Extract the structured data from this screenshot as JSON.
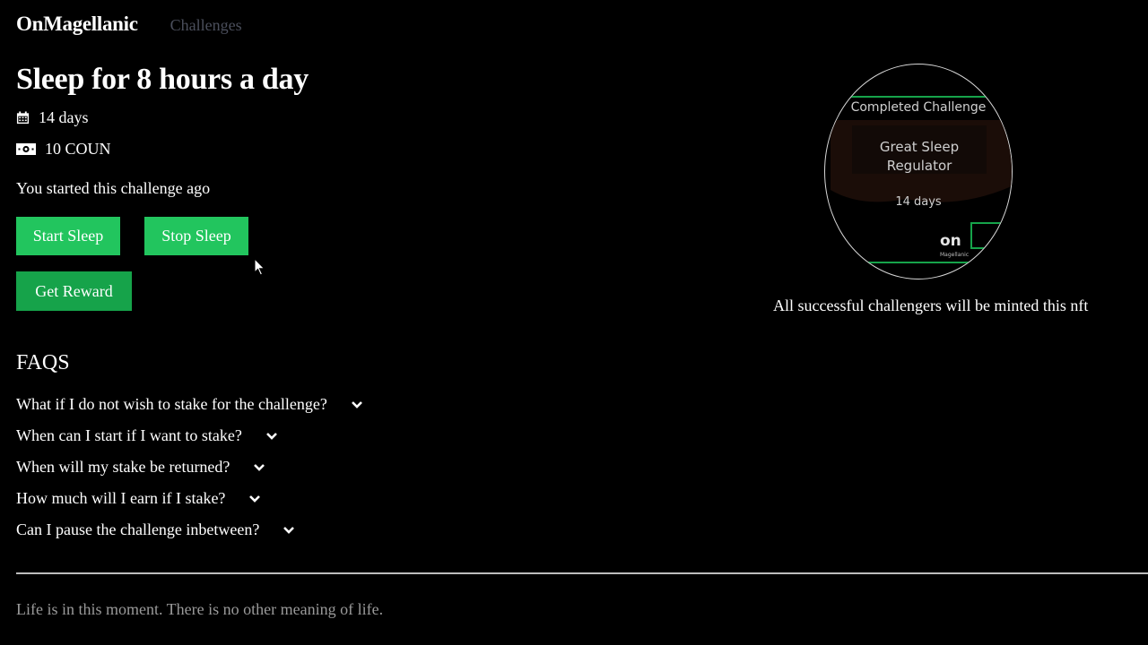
{
  "nav": {
    "brand": "OnMagellanic",
    "challenges_link": "Challenges"
  },
  "challenge": {
    "title": "Sleep for 8 hours a day",
    "duration": "14 days",
    "reward": "10 COUN",
    "status_text": "You started this challenge ago"
  },
  "buttons": {
    "start": "Start Sleep",
    "stop": "Stop Sleep",
    "reward": "Get Reward"
  },
  "colors": {
    "button_green": "#22c55e",
    "reward_green": "#16a34a",
    "nft_accent": "#16a34a"
  },
  "icons": {
    "duration": "calendar-icon",
    "reward": "money-icon",
    "faq_toggle": "chevron-down-icon",
    "cursor": "mouse-pointer-icon"
  },
  "faqs": {
    "title": "FAQS",
    "items": [
      {
        "question": "What if I do not wish to stake for the challenge?"
      },
      {
        "question": "When can I start if I want to stake?"
      },
      {
        "question": "When will my stake be returned?"
      },
      {
        "question": "How much will I earn if I stake?"
      },
      {
        "question": "Can I pause the challenge inbetween?"
      }
    ]
  },
  "nft": {
    "header": "Completed Challenge",
    "name": "Great Sleep Regulator",
    "days": "14 days",
    "logo": "on",
    "logo_small": "Magellanic",
    "caption": "All successful challengers will be minted this nft"
  },
  "footer": {
    "quote": "Life is in this moment. There is no other meaning of life."
  }
}
